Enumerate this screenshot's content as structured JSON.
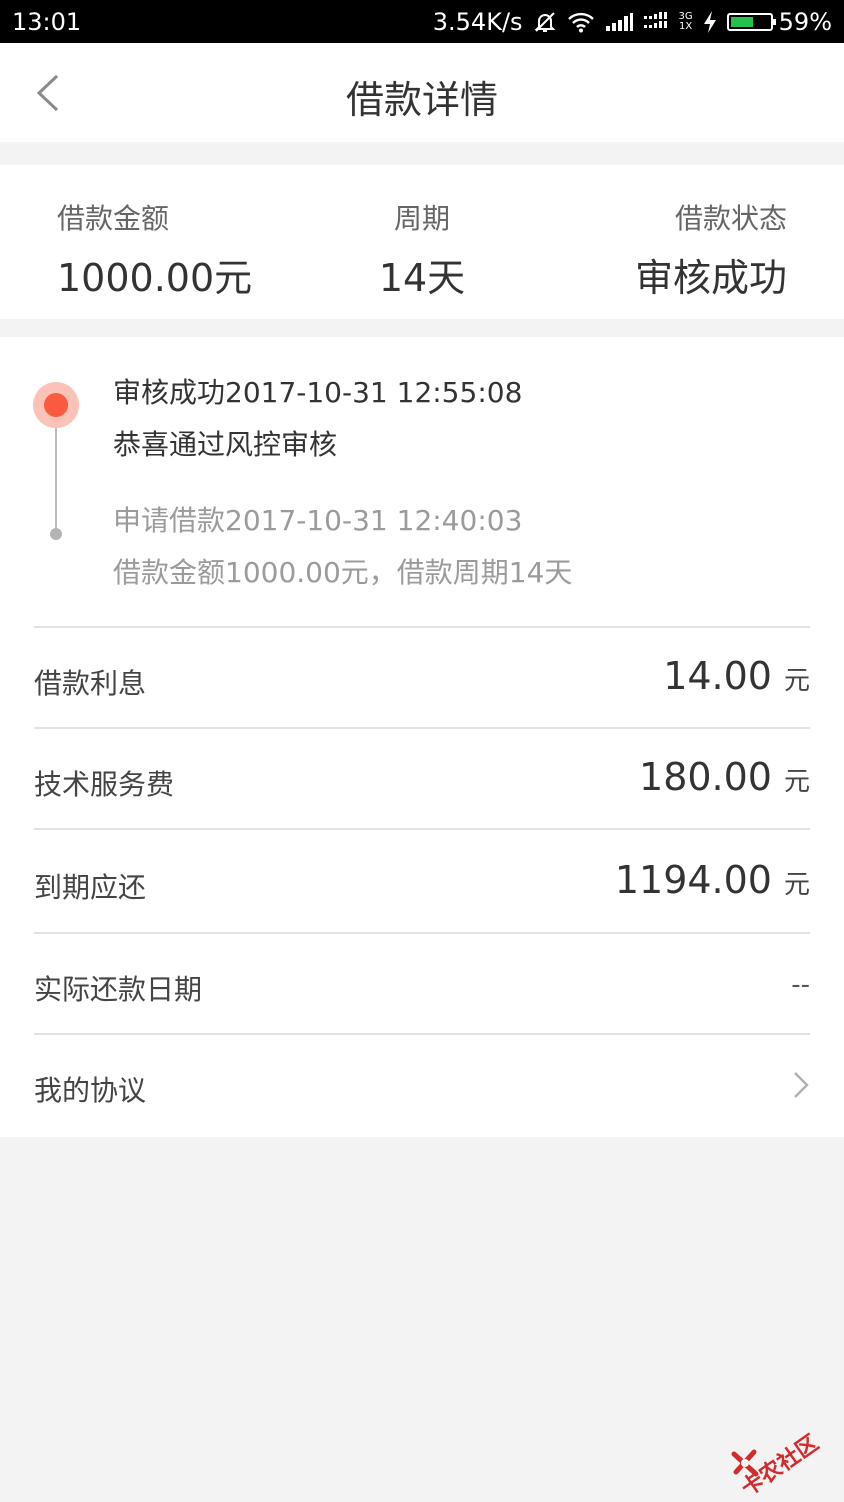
{
  "status_bar": {
    "time": "13:01",
    "speed": "3.54K/s",
    "net_top": "3G",
    "net_bottom": "1X",
    "battery_percent_text": "59%",
    "battery_level": 0.59,
    "icons": [
      "bell-off-icon",
      "wifi-icon",
      "signal-icon",
      "signal-icon",
      "charging-icon",
      "battery-icon"
    ]
  },
  "nav": {
    "title": "借款详情",
    "back_icon": "chevron-left-icon"
  },
  "summary": {
    "amount_label": "借款金额",
    "amount_value": "1000.00元",
    "period_label": "周期",
    "period_value": "14天",
    "status_label": "借款状态",
    "status_value": "审核成功"
  },
  "timeline": [
    {
      "title": "审核成功2017-10-31 12:55:08",
      "desc": "恭喜通过风控审核",
      "active": true
    },
    {
      "title": "申请借款2017-10-31 12:40:03",
      "desc": "借款金额1000.00元，借款周期14天",
      "active": false
    }
  ],
  "rows": {
    "interest": {
      "label": "借款利息",
      "amount": "14.00",
      "unit": "元"
    },
    "service_fee": {
      "label": "技术服务费",
      "amount": "180.00",
      "unit": "元"
    },
    "due": {
      "label": "到期应还",
      "amount": "1194.00",
      "unit": "元"
    },
    "repay_date": {
      "label": "实际还款日期",
      "value": "--"
    },
    "agreement": {
      "label": "我的协议",
      "icon": "chevron-right-icon"
    }
  },
  "watermark": {
    "text": "卡农社区"
  },
  "colors": {
    "accent": "#fa5a3e",
    "accent_light": "#fbc2b8",
    "battery": "#27c24c",
    "watermark": "#d42a2a"
  }
}
